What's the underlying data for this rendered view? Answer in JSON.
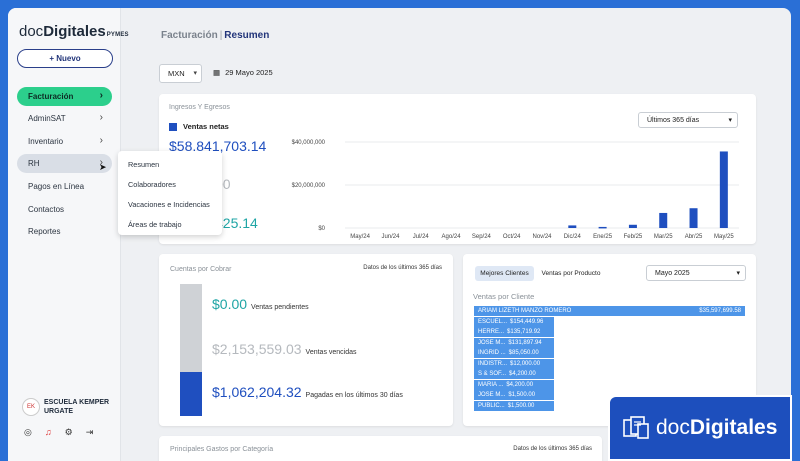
{
  "brand": {
    "logo_part1": "doc",
    "logo_part2": "Digitales",
    "logo_suffix": "PYMES"
  },
  "sidebar": {
    "new_button": "+ Nuevo",
    "items": [
      {
        "label": "Facturación",
        "chevron": true
      },
      {
        "label": "AdminSAT",
        "chevron": true
      },
      {
        "label": "Inventario",
        "chevron": true
      },
      {
        "label": "RH",
        "chevron": true
      },
      {
        "label": "Pagos en Línea",
        "chevron": false
      },
      {
        "label": "Contactos",
        "chevron": false
      },
      {
        "label": "Reportes",
        "chevron": false
      }
    ],
    "submenu": [
      "Resumen",
      "Colaboradores",
      "Vacaciones e Incidencias",
      "Áreas de trabajo"
    ],
    "user": {
      "name": "ESCUELA KEMPER URGATE",
      "avatar_text": "EK"
    },
    "icons": [
      "user-circle-icon",
      "bell-icon",
      "gear-icon",
      "logout-icon"
    ]
  },
  "header": {
    "section": "Facturación",
    "separator": "|",
    "current": "Resumen"
  },
  "filters": {
    "currency": "MXN",
    "date": "29 Mayo 2025"
  },
  "ingresos": {
    "title": "Ingresos Y Egresos",
    "legend": "Ventas netas",
    "amount_ventas": "$58,841,703.14",
    "amount_partial_1": "s",
    "amount_partial_2": "00",
    "amount_partial_3": "425.14",
    "range": "Últimos 365 días"
  },
  "chart_data": {
    "type": "bar",
    "categories": [
      "May/24",
      "Jun/24",
      "Jul/24",
      "Ago/24",
      "Sep/24",
      "Oct/24",
      "Nov/24",
      "Dic/24",
      "Ene/25",
      "Feb/25",
      "Mar/25",
      "Abr/25",
      "May/25"
    ],
    "series": [
      {
        "name": "Ventas netas",
        "values": [
          0,
          0,
          0,
          0,
          0,
          0,
          0,
          1200000,
          500000,
          1500000,
          7000000,
          9200000,
          35600000
        ]
      }
    ],
    "yticks": [
      "$40,000,000",
      "$20,000,000",
      "$0"
    ],
    "ylim": [
      0,
      40000000
    ],
    "grid": true,
    "color": "#1f4fbf"
  },
  "cxc": {
    "title": "Cuentas por Cobrar",
    "subtitle": "Datos de los últimos 365 días",
    "pendientes": {
      "amount": "$0.00",
      "label": "Ventas pendientes",
      "color": "#1fa5a5"
    },
    "vencidas": {
      "amount": "$2,153,559.03",
      "label": "Ventas vencidas",
      "color": "#b5b9be"
    },
    "pagadas": {
      "amount": "$1,062,204.32",
      "label": "Pagadas en los últimos 30 días",
      "color": "#1f4fbf"
    },
    "bar_fraction_paid": 0.33
  },
  "clientes": {
    "tabs": [
      "Mejores Clientes",
      "Ventas por Producto"
    ],
    "month": "Mayo 2025",
    "title": "Ventas por Cliente",
    "rows": [
      {
        "name": "ARIAM LIZETH MANZO ROMERO",
        "amount": "$35,597,699.58",
        "value": 35597699.58
      },
      {
        "name": "ESCUEL...",
        "amount": "$154,449.96",
        "value": 154449.96
      },
      {
        "name": "HERRE...",
        "amount": "$135,719.92",
        "value": 135719.92
      },
      {
        "name": "JOSE M...",
        "amount": "$131,897.94",
        "value": 131897.94
      },
      {
        "name": "INGRID ...",
        "amount": "$85,050.00",
        "value": 85050
      },
      {
        "name": "INDISTR...",
        "amount": "$12,000.00",
        "value": 12000
      },
      {
        "name": "S & SOF...",
        "amount": "$4,200.00",
        "value": 4200
      },
      {
        "name": "MARIA ...",
        "amount": "$4,200.00",
        "value": 4200
      },
      {
        "name": "JOSE M...",
        "amount": "$1,500.00",
        "value": 1500
      },
      {
        "name": "PUBLIC...",
        "amount": "$1,500.00",
        "value": 1500
      }
    ]
  },
  "gastos": {
    "title": "Principales Gastos por Categoría",
    "subtitle": "Datos de los últimos 365 días"
  },
  "watermark": {
    "part1": "doc",
    "part2": "Digitales"
  }
}
